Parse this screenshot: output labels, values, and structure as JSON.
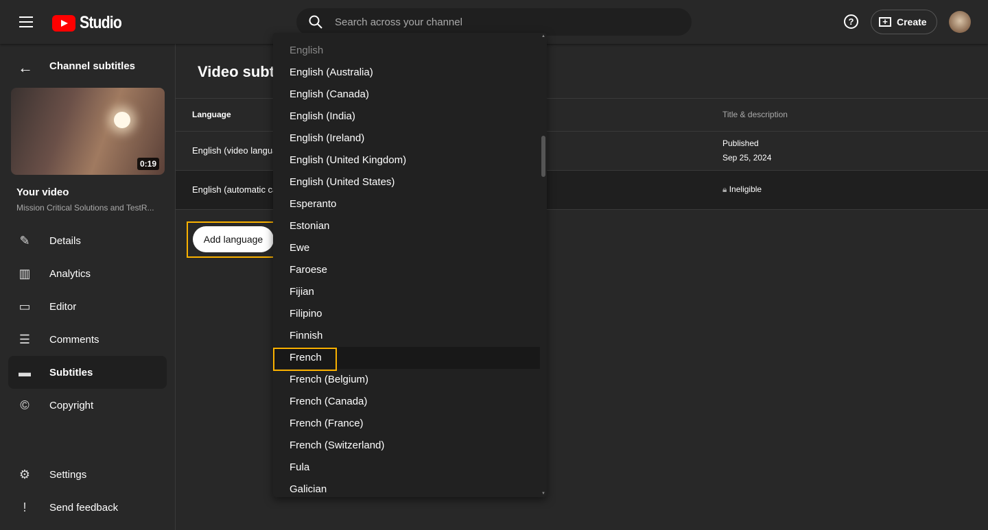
{
  "header": {
    "logo_text": "Studio",
    "search_placeholder": "Search across your channel",
    "create_label": "Create"
  },
  "sidebar": {
    "back_label": "Channel subtitles",
    "video_duration": "0:19",
    "video_heading": "Your video",
    "video_title": "Mission Critical Solutions and TestR...",
    "items": [
      {
        "label": "Details",
        "icon": "pencil-icon"
      },
      {
        "label": "Analytics",
        "icon": "analytics-icon"
      },
      {
        "label": "Editor",
        "icon": "clapperboard-icon"
      },
      {
        "label": "Comments",
        "icon": "comment-icon"
      },
      {
        "label": "Subtitles",
        "icon": "subtitles-icon",
        "selected": true
      },
      {
        "label": "Copyright",
        "icon": "copyright-icon"
      }
    ],
    "bottom": [
      {
        "label": "Settings",
        "icon": "gear-icon"
      },
      {
        "label": "Send feedback",
        "icon": "feedback-icon"
      }
    ]
  },
  "main": {
    "title": "Video subtitles",
    "columns": {
      "language": "Language",
      "title_desc": "Title & description"
    },
    "rows": [
      {
        "language": "English (video language)",
        "title_desc": "Published",
        "date": "Sep 25, 2024"
      },
      {
        "language": "English (automatic captions)",
        "title_desc": "Ineligible"
      }
    ],
    "add_language": "Add language"
  },
  "dropdown": {
    "options": [
      "English",
      "English (Australia)",
      "English (Canada)",
      "English (India)",
      "English (Ireland)",
      "English (United Kingdom)",
      "English (United States)",
      "Esperanto",
      "Estonian",
      "Ewe",
      "Faroese",
      "Fijian",
      "Filipino",
      "Finnish",
      "French",
      "French (Belgium)",
      "French (Canada)",
      "French (France)",
      "French (Switzerland)",
      "Fula",
      "Galician"
    ],
    "disabled": "English",
    "highlighted": "French"
  },
  "colors": {
    "highlight_border": "#fbb200",
    "brand": "#ff0000"
  }
}
